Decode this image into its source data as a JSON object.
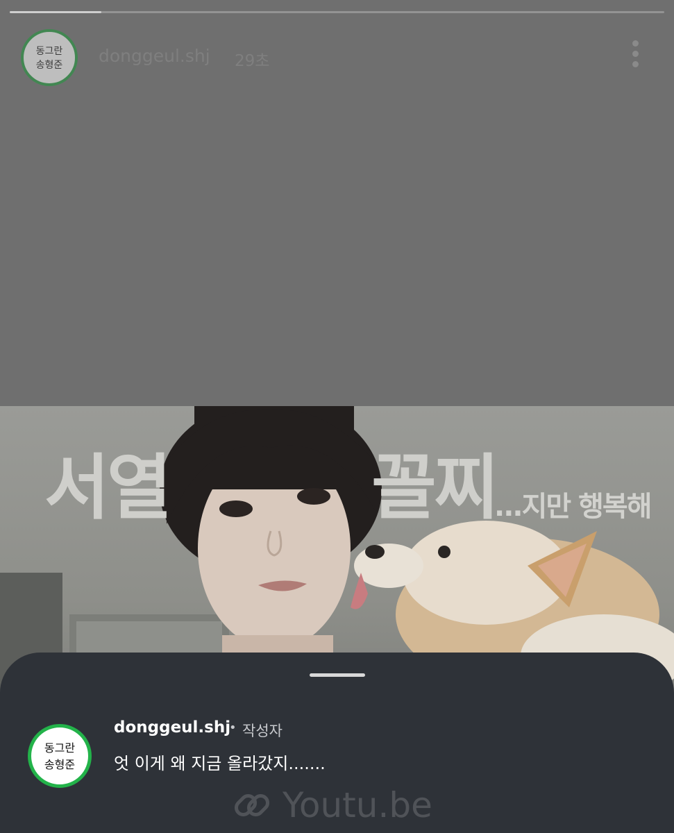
{
  "story": {
    "progress_fraction": 0.14,
    "username": "donggeul.shj",
    "time": "29초",
    "avatar_text_line1": "동그란",
    "avatar_text_line2": "송형준"
  },
  "media": {
    "title_left": "서열",
    "title_right": "꼴찌",
    "subtitle": "...지만 행복해"
  },
  "comment": {
    "username": "donggeul.shj",
    "separator": "•",
    "author_tag": "작성자",
    "text": "엇 이게 왜 지금 올라갔지.......",
    "link_label": "Youtu.be"
  },
  "colors": {
    "avatar_ring": "#23b34a",
    "sheet_bg": "#2e3238"
  }
}
